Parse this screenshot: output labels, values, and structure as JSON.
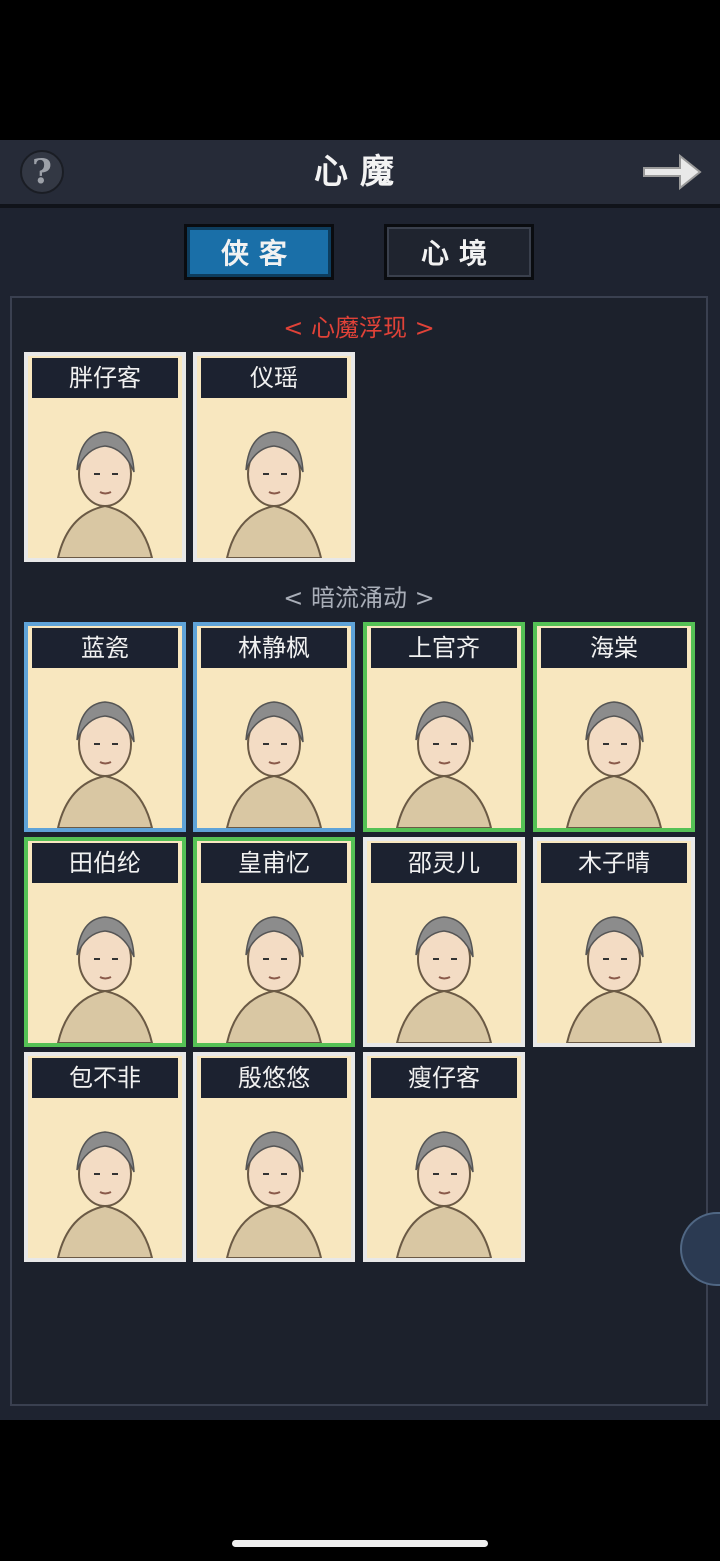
{
  "header": {
    "title": "心魔",
    "help_icon": "help-icon",
    "next_icon": "arrow-right-icon"
  },
  "tabs": [
    {
      "label": "侠客",
      "active": true
    },
    {
      "label": "心境",
      "active": false
    }
  ],
  "sections": [
    {
      "title": "< 心魔浮现 >",
      "color": "#e04238",
      "heroes": [
        {
          "name": "胖仔客",
          "frame": "white"
        },
        {
          "name": "仪瑶",
          "frame": "white"
        }
      ]
    },
    {
      "title": "< 暗流涌动 >",
      "color": "#a9aeb8",
      "heroes": [
        {
          "name": "蓝瓷",
          "frame": "blue"
        },
        {
          "name": "林静枫",
          "frame": "blue"
        },
        {
          "name": "上官齐",
          "frame": "green"
        },
        {
          "name": "海棠",
          "frame": "green"
        },
        {
          "name": "田伯纶",
          "frame": "green"
        },
        {
          "name": "皇甫忆",
          "frame": "green"
        },
        {
          "name": "邵灵儿",
          "frame": "white"
        },
        {
          "name": "木子晴",
          "frame": "white"
        },
        {
          "name": "包不非",
          "frame": "white"
        },
        {
          "name": "殷悠悠",
          "frame": "white"
        },
        {
          "name": "瘦仔客",
          "frame": "white"
        }
      ]
    }
  ],
  "colors": {
    "accent_tab": "#1a6fa8",
    "frame_blue": "#5fa3d8",
    "frame_green": "#55c155",
    "frame_white": "#e8e8e8"
  }
}
